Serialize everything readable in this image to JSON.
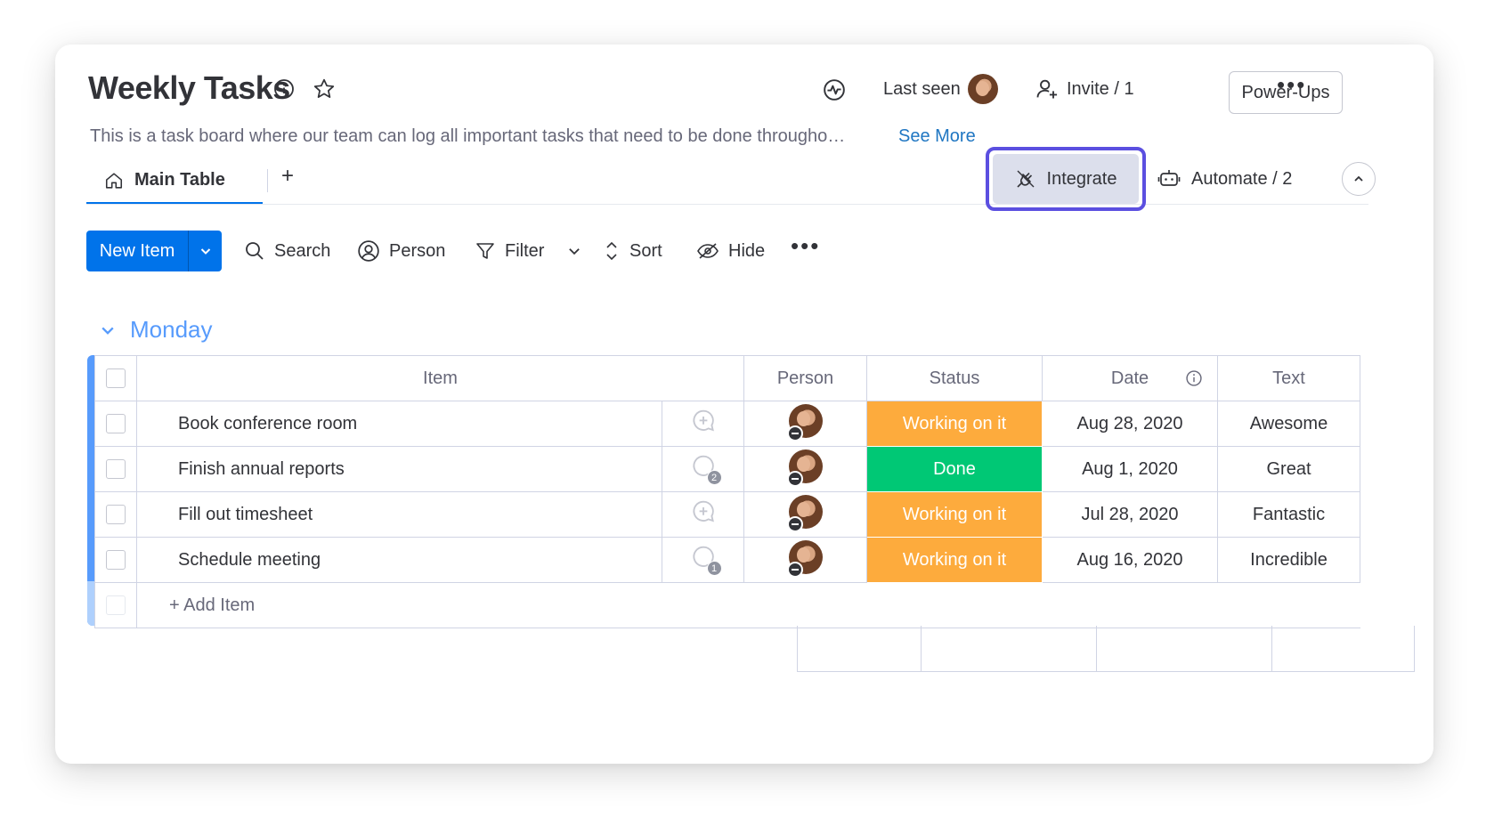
{
  "board": {
    "title": "Weekly Tasks",
    "description": "This is a task board where our team can log all important tasks that need to be done througho…",
    "see_more": "See More"
  },
  "header": {
    "last_seen": "Last seen",
    "invite": "Invite / 1",
    "power_ups": "Power-Ups"
  },
  "tabs": {
    "main": "Main Table",
    "add": "+",
    "integrate": "Integrate",
    "automate": "Automate / 2"
  },
  "toolbar": {
    "new_item": "New Item",
    "search": "Search",
    "person": "Person",
    "filter": "Filter",
    "sort": "Sort",
    "hide": "Hide"
  },
  "group": {
    "title": "Monday",
    "columns": {
      "item": "Item",
      "person": "Person",
      "status": "Status",
      "date": "Date",
      "text": "Text"
    },
    "rows": [
      {
        "item": "Book conference room",
        "updates": "",
        "status": "Working on it",
        "status_color": "#fdab3d",
        "date": "Aug 28, 2020",
        "text": "Awesome"
      },
      {
        "item": "Finish annual reports",
        "updates": "2",
        "status": "Done",
        "status_color": "#00c875",
        "date": "Aug 1, 2020",
        "text": "Great"
      },
      {
        "item": "Fill out timesheet",
        "updates": "",
        "status": "Working on it",
        "status_color": "#fdab3d",
        "date": "Jul 28, 2020",
        "text": "Fantastic"
      },
      {
        "item": "Schedule meeting",
        "updates": "1",
        "status": "Working on it",
        "status_color": "#fdab3d",
        "date": "Aug 16, 2020",
        "text": "Incredible"
      }
    ],
    "add_item": "+ Add Item"
  },
  "colors": {
    "accent": "#0073ea",
    "group": "#579bfc",
    "highlight_outline": "#5b4fe0",
    "working": "#fdab3d",
    "done": "#00c875"
  }
}
